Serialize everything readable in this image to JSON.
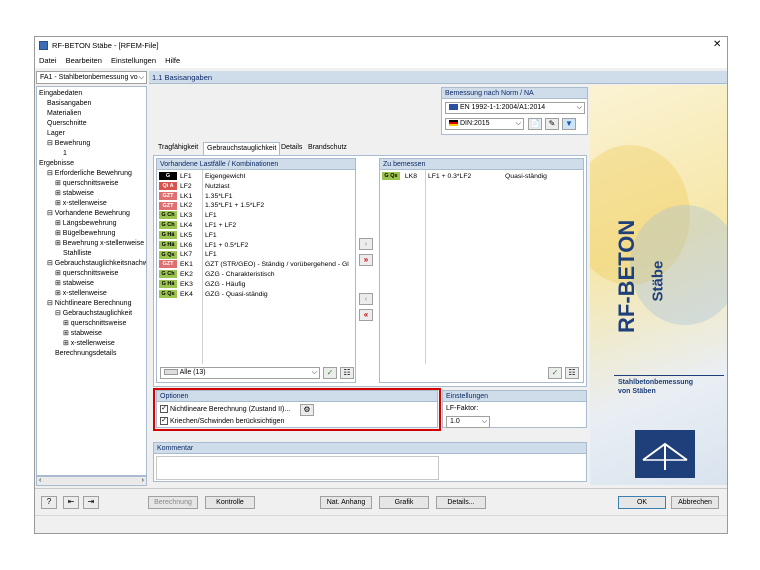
{
  "window": {
    "title": "RF-BETON Stäbe - [RFEM-File]",
    "close": "✕"
  },
  "menu": [
    "Datei",
    "Bearbeiten",
    "Einstellungen",
    "Hilfe"
  ],
  "case_select": "FA1 - Stahlbetonbemessung vo",
  "section_title": "1.1 Basisangaben",
  "tree": [
    {
      "label": "Eingabedaten",
      "indent": 0
    },
    {
      "label": "Basisangaben",
      "indent": 1
    },
    {
      "label": "Materialien",
      "indent": 1
    },
    {
      "label": "Querschnitte",
      "indent": 1
    },
    {
      "label": "Lager",
      "indent": 1
    },
    {
      "label": "⊟ Bewehrung",
      "indent": 1
    },
    {
      "label": "1",
      "indent": 3
    },
    {
      "label": "Ergebnisse",
      "indent": 0
    },
    {
      "label": "⊟ Erforderliche Bewehrung",
      "indent": 1
    },
    {
      "label": "⊞ querschnittsweise",
      "indent": 2
    },
    {
      "label": "⊞ stabweise",
      "indent": 2
    },
    {
      "label": "⊞ x-stellenweise",
      "indent": 2
    },
    {
      "label": "⊟ Vorhandene Bewehrung",
      "indent": 1
    },
    {
      "label": "⊞ Längsbewehrung",
      "indent": 2
    },
    {
      "label": "⊞ Bügelbewehrung",
      "indent": 2
    },
    {
      "label": "⊞ Bewehrung x-stellenweise",
      "indent": 2
    },
    {
      "label": "Stahlliste",
      "indent": 3
    },
    {
      "label": "⊟ Gebrauchstauglichkeitsnachwei",
      "indent": 1
    },
    {
      "label": "⊞ querschnittsweise",
      "indent": 2
    },
    {
      "label": "⊞ stabweise",
      "indent": 2
    },
    {
      "label": "⊞ x-stellenweise",
      "indent": 2
    },
    {
      "label": "⊟ Nichtlineare Berechnung",
      "indent": 1
    },
    {
      "label": "⊟ Gebrauchstauglichkeit",
      "indent": 2
    },
    {
      "label": "⊞ querschnittsweise",
      "indent": 3
    },
    {
      "label": "⊞ stabweise",
      "indent": 3
    },
    {
      "label": "⊞ x-stellenweise",
      "indent": 3
    },
    {
      "label": "Berechnungsdetails",
      "indent": 2
    }
  ],
  "norm": {
    "header": "Bemessung nach Norm / NA",
    "standard": "EN 1992-1-1:2004/A1:2014",
    "annex": "DIN:2015"
  },
  "tabs": [
    "Tragfähigkeit",
    "Gebrauchstauglichkeit",
    "Details",
    "Brandschutz"
  ],
  "loads": {
    "header": "Vorhandene Lastfälle / Kombinationen",
    "rows": [
      {
        "tag": "G",
        "tag_color": "#000000",
        "tag_text": "#ffffff",
        "id": "LF1",
        "desc": "Eigengewicht"
      },
      {
        "tag": "Qi A",
        "tag_color": "#d9534f",
        "tag_text": "#ffffff",
        "id": "LF2",
        "desc": "Nutzlast"
      },
      {
        "tag": "GZT",
        "tag_color": "#e07070",
        "tag_text": "#ffffff",
        "id": "LK1",
        "desc": "1.35*LF1"
      },
      {
        "tag": "GZT",
        "tag_color": "#e07070",
        "tag_text": "#ffffff",
        "id": "LK2",
        "desc": "1.35*LF1 + 1.5*LF2"
      },
      {
        "tag": "G Ch",
        "tag_color": "#9bc34f",
        "tag_text": "#000000",
        "id": "LK3",
        "desc": "LF1"
      },
      {
        "tag": "G Ch",
        "tag_color": "#9bc34f",
        "tag_text": "#000000",
        "id": "LK4",
        "desc": "LF1 + LF2"
      },
      {
        "tag": "G Hä",
        "tag_color": "#9bc34f",
        "tag_text": "#000000",
        "id": "LK5",
        "desc": "LF1"
      },
      {
        "tag": "G Hä",
        "tag_color": "#9bc34f",
        "tag_text": "#000000",
        "id": "LK6",
        "desc": "LF1 + 0.5*LF2"
      },
      {
        "tag": "G Qs",
        "tag_color": "#9bc34f",
        "tag_text": "#000000",
        "id": "LK7",
        "desc": "LF1"
      },
      {
        "tag": "GZT",
        "tag_color": "#e07070",
        "tag_text": "#ffffff",
        "id": "EK1",
        "desc": "GZT (STR/GEO) - Ständig / vorübergehend - Gl"
      },
      {
        "tag": "G Ch",
        "tag_color": "#9bc34f",
        "tag_text": "#000000",
        "id": "EK2",
        "desc": "GZG - Charakteristisch"
      },
      {
        "tag": "G Hä",
        "tag_color": "#9bc34f",
        "tag_text": "#000000",
        "id": "EK3",
        "desc": "GZG - Häufig"
      },
      {
        "tag": "G Qs",
        "tag_color": "#9bc34f",
        "tag_text": "#000000",
        "id": "EK4",
        "desc": "GZG - Quasi-ständig"
      }
    ],
    "filter": "Alle (13)"
  },
  "design": {
    "header": "Zu bemessen",
    "rows": [
      {
        "tag": "G Qs",
        "id": "LK8",
        "desc": "LF1 + 0.3*LF2",
        "type": "Quasi-ständig"
      }
    ]
  },
  "options": {
    "header": "Optionen",
    "nonlinear": "Nichtlineare Berechnung (Zustand II)...",
    "creep": "Kriechen/Schwinden berücksichtigen"
  },
  "settings": {
    "header": "Einstellungen",
    "lf_label": "LF-Faktor:",
    "lf_value": "1.0"
  },
  "comment": {
    "header": "Kommentar"
  },
  "banner": {
    "title": "RF-BETON",
    "subtitle": "Stäbe",
    "description_1": "Stahlbetonbemessung",
    "description_2": "von Stäben"
  },
  "footer": {
    "berechnung": "Berechnung",
    "kontrolle": "Kontrolle",
    "nat_anhang": "Nat. Anhang",
    "grafik": "Grafik",
    "details": "Details...",
    "ok": "OK",
    "abbrechen": "Abbrechen"
  },
  "colors": {
    "accent": "#cfdcea",
    "highlight": "#d40000",
    "logo_blue": "#1e3f7a"
  }
}
